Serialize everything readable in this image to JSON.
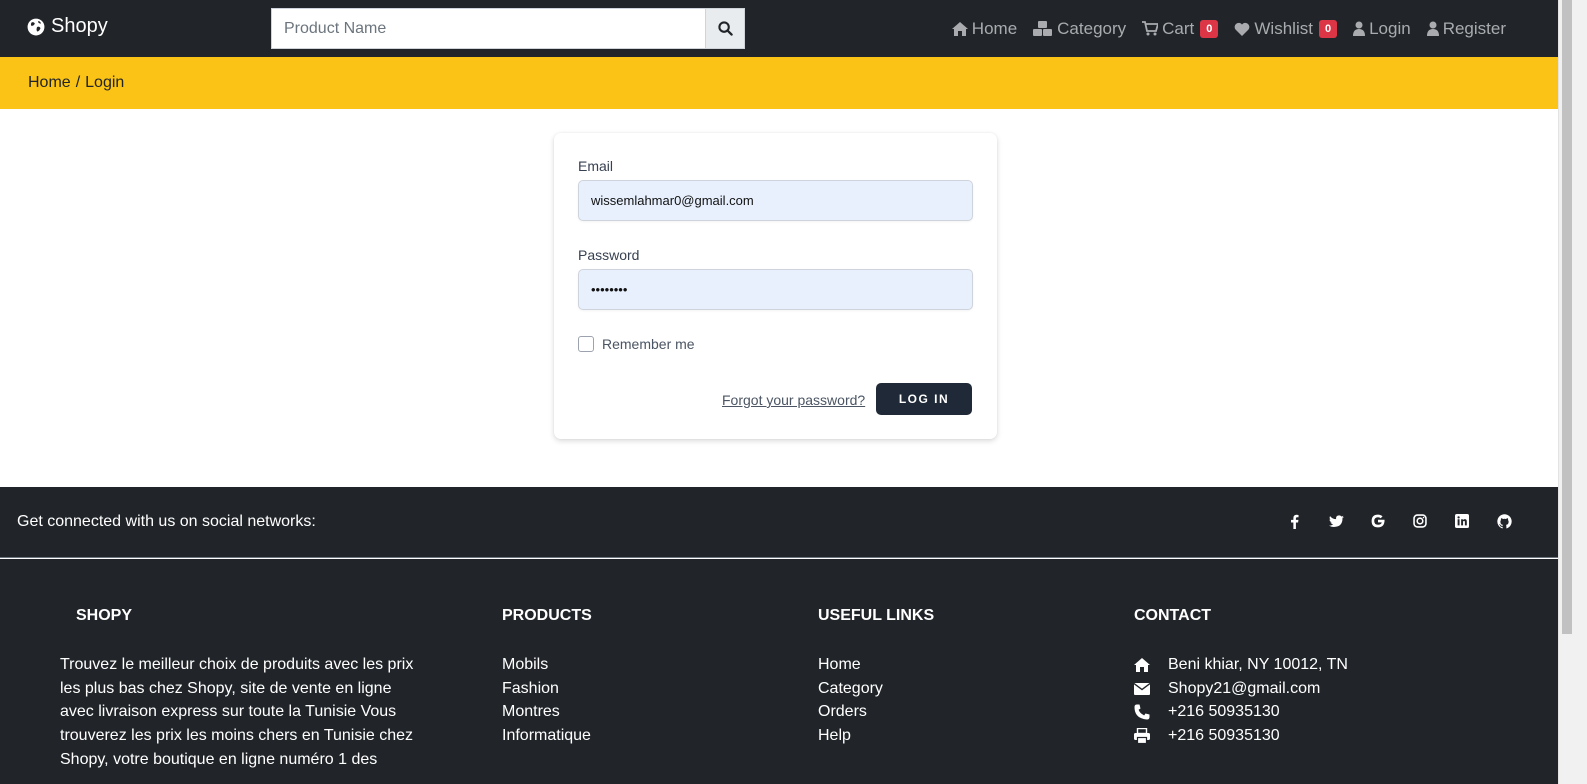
{
  "navbar": {
    "brand": "Shopy",
    "search_placeholder": "Product Name",
    "links": {
      "home": "Home",
      "category": "Category",
      "cart": "Cart",
      "cart_count": "0",
      "wishlist": "Wishlist",
      "wishlist_count": "0",
      "login": "Login",
      "register": "Register"
    }
  },
  "breadcrumb": {
    "home": "Home",
    "separator": "/",
    "current": "Login"
  },
  "login_form": {
    "email_label": "Email",
    "email_value": "wissemlahmar0@gmail.com",
    "password_label": "Password",
    "password_value": "••••••••",
    "remember_label": "Remember me",
    "remember_checked": false,
    "forgot_link": "Forgot your password?",
    "submit_label": "LOG IN"
  },
  "social": {
    "text": "Get connected with us on social networks:",
    "icons": [
      "facebook-icon",
      "twitter-icon",
      "google-icon",
      "instagram-icon",
      "linkedin-icon",
      "github-icon"
    ]
  },
  "footer": {
    "about": {
      "icon_glyph": "",
      "title": "SHOPY",
      "text": "Trouvez le meilleur choix de produits avec les prix les plus bas chez Shopy, site de vente en ligne avec livraison express sur toute la Tunisie Vous trouverez les prix les moins chers en Tunisie chez Shopy, votre boutique en ligne numéro 1 des"
    },
    "products": {
      "title": "PRODUCTS",
      "items": [
        "Mobils",
        "Fashion",
        "Montres",
        "Informatique"
      ]
    },
    "useful_links": {
      "title": "USEFUL LINKS",
      "items": [
        "Home",
        "Category",
        "Orders",
        "Help"
      ]
    },
    "contact": {
      "title": "CONTACT",
      "address": "Beni khiar, NY 10012, TN",
      "email": "Shopy21@gmail.com",
      "phone": "+216 50935130",
      "fax": "+216 50935130"
    }
  },
  "colors": {
    "dark": "#212529",
    "accent_yellow": "#fbc315",
    "badge_red": "#dc3545",
    "input_bg": "#e8f0fe",
    "button_dark": "#1f2937"
  }
}
